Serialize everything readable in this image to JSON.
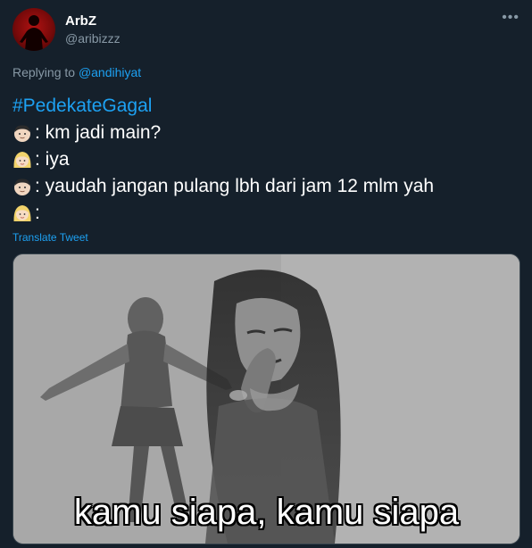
{
  "tweet": {
    "author_name": "ArbZ",
    "author_handle": "@aribizzz",
    "more_icon": "ellipsis-icon",
    "replying_prefix": "Replying to",
    "replying_to": "@andihiyat",
    "hashtag": "#PedekateGagal",
    "lines": [
      {
        "emoji": "man-face-icon",
        "text": ": km jadi main?"
      },
      {
        "emoji": "blonde-woman-face-icon",
        "text": ": iya"
      },
      {
        "emoji": "man-face-icon",
        "text": ": yaudah jangan pulang lbh dari jam 12 mlm yah"
      },
      {
        "emoji": "blonde-woman-face-icon",
        "text": ":"
      }
    ],
    "translate_label": "Translate Tweet",
    "media_caption": "kamu siapa, kamu siapa"
  },
  "colors": {
    "background": "#15202b",
    "accent": "#1da1f2",
    "secondary_text": "#8899a6"
  }
}
